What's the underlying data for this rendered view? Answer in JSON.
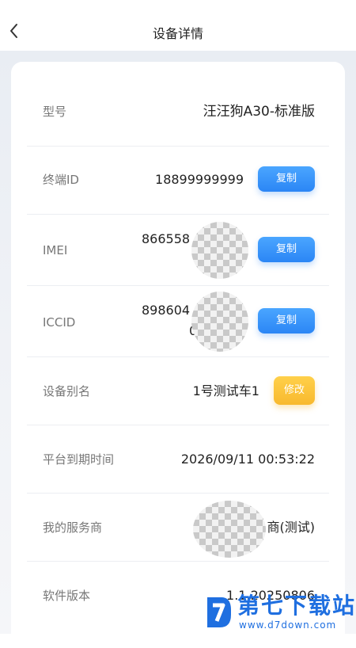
{
  "header": {
    "title": "设备详情",
    "back_icon": "chevron-left-icon"
  },
  "rows": {
    "model": {
      "label": "型号",
      "value": "汪汪狗A30-标准版"
    },
    "terminal_id": {
      "label": "终端ID",
      "value": "18899999999",
      "button": "复制"
    },
    "imei": {
      "label": "IMEI",
      "value_line1": "866558",
      "value_line2": "",
      "button": "复制"
    },
    "iccid": {
      "label": "ICCID",
      "value_line1": "898604",
      "value_line2": "0",
      "button": "复制"
    },
    "alias": {
      "label": "设备别名",
      "value": "1号测试车1",
      "button": "修改"
    },
    "expire": {
      "label": "平台到期时间",
      "value": "2026/09/11 00:53:22"
    },
    "provider": {
      "label": "我的服务商",
      "value": "商(测试)"
    },
    "version": {
      "label": "软件版本",
      "value": "1.1.20250806"
    }
  },
  "watermark": {
    "brand": "第七下载站",
    "url": "www.d7down.com"
  },
  "colors": {
    "accent_blue": "#2b86f5",
    "accent_yellow": "#f8b92e",
    "watermark_blue": "#1f6fe0"
  }
}
